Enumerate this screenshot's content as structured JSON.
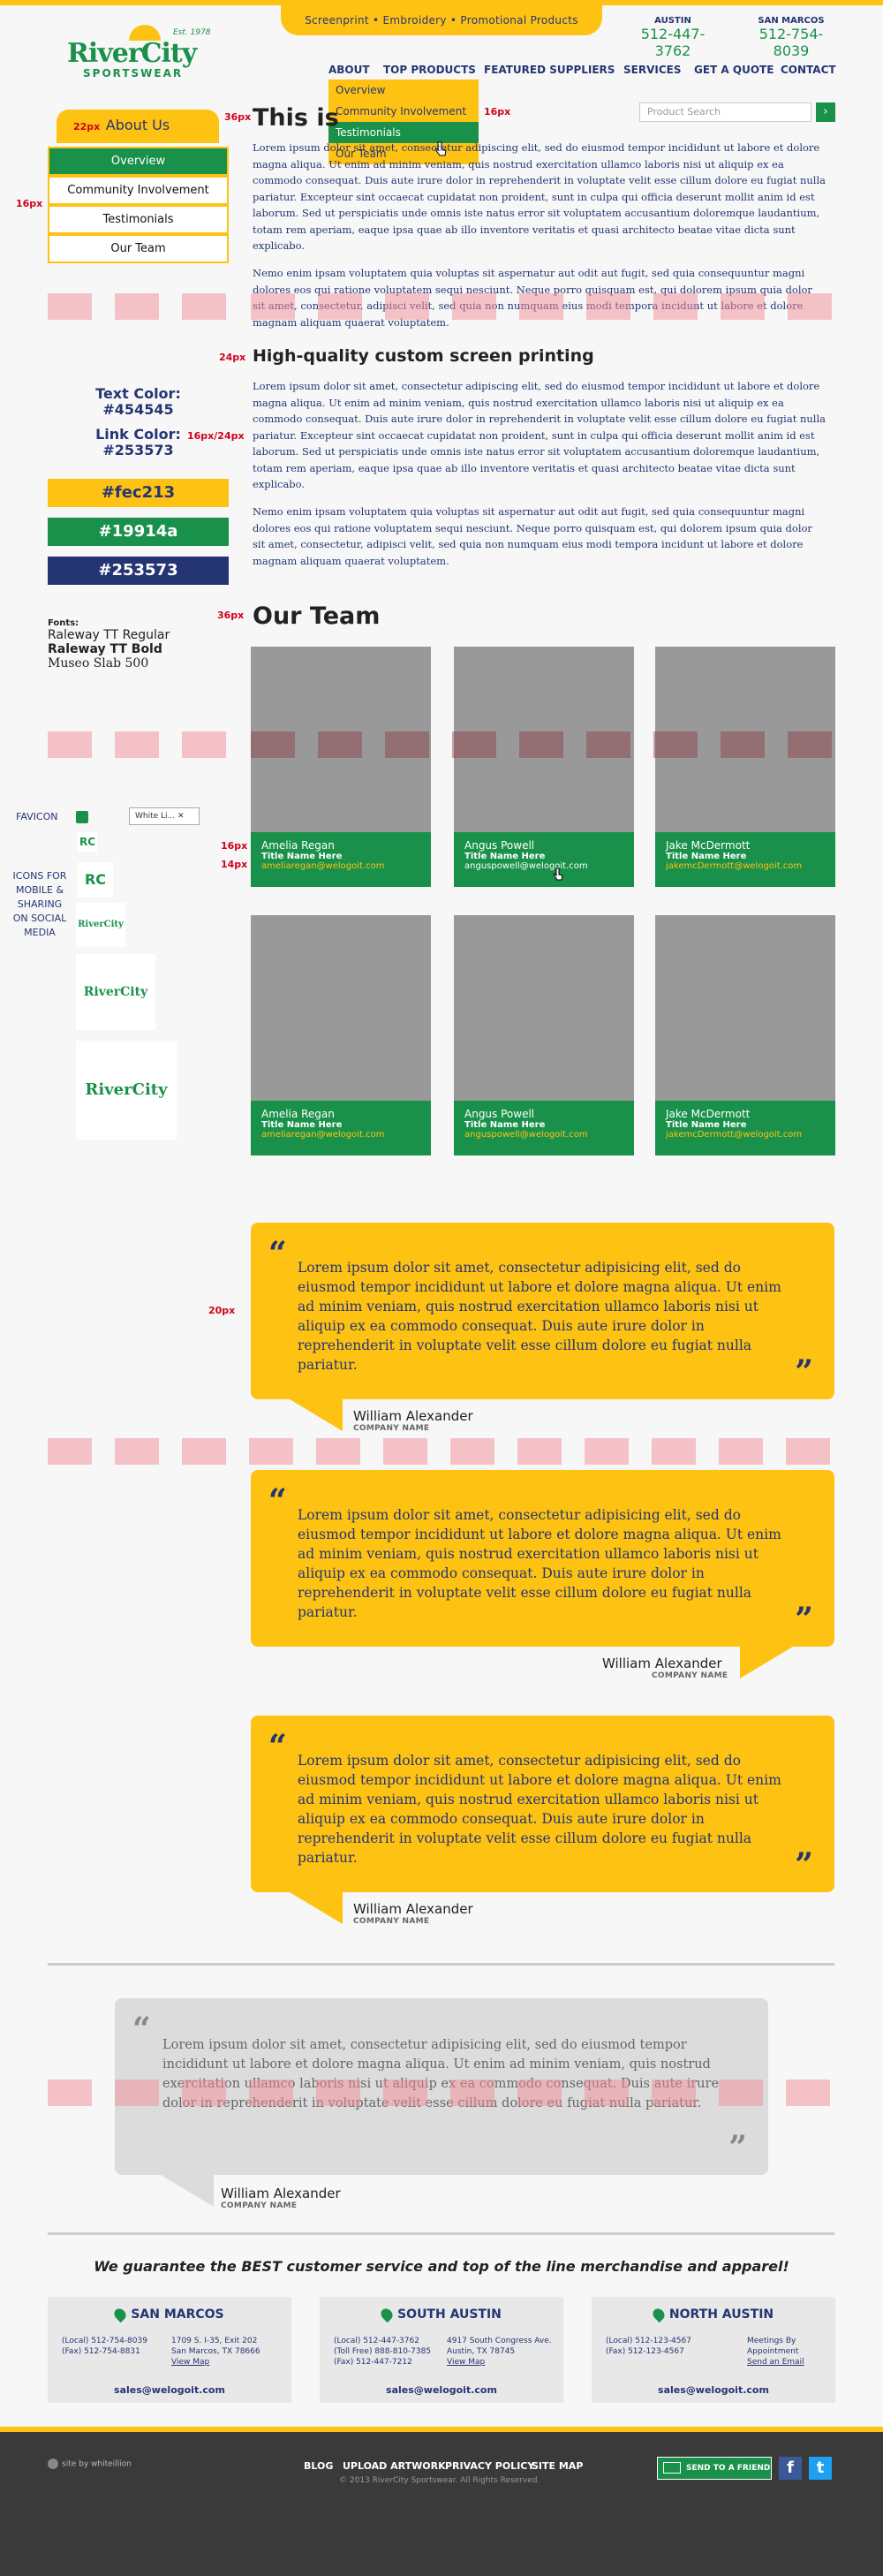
{
  "header": {
    "tagline": "Screenprint • Embroidery • Promotional Products",
    "logo": {
      "name": "RiverCity",
      "sub": "SPORTSWEAR",
      "est": "Est. 1978"
    },
    "cities": [
      {
        "name": "AUSTIN",
        "phone": "512-447-3762"
      },
      {
        "name": "SAN MARCOS",
        "phone": "512-754-8039"
      }
    ]
  },
  "nav": {
    "items": [
      "ABOUT",
      "TOP PRODUCTS",
      "FEATURED SUPPLIERS",
      "SERVICES",
      "GET A QUOTE",
      "CONTACT"
    ],
    "dropdown": [
      "Overview",
      "Community Involvement",
      "Testimonials",
      "Our Team"
    ]
  },
  "search": {
    "placeholder": "Product Search"
  },
  "sidebar": {
    "title": "About Us",
    "items": [
      "Overview",
      "Community Involvement",
      "Testimonials",
      "Our Team"
    ]
  },
  "annotations": {
    "px22": "22px",
    "px36": "36px",
    "px16": "16px",
    "px24": "24px",
    "px16_24": "16px/24px",
    "px14": "14px",
    "px20": "20px"
  },
  "main": {
    "h1": "This is",
    "p1": "Lorem ipsum dolor sit amet, consectetur adipiscing elit, sed do eiusmod tempor incididunt ut labore et dolore magna aliqua. Ut enim ad minim veniam, quis nostrud exercitation ullamco laboris nisi ut aliquip ex ea commodo consequat. Duis aute irure dolor in reprehenderit in voluptate velit esse cillum dolore eu fugiat nulla pariatur. Excepteur sint occaecat cupidatat non proident, sunt in culpa qui officia deserunt mollit anim id est laborum. Sed ut perspiciatis unde omnis iste natus error sit voluptatem accusantium doloremque laudantium, totam rem aperiam, eaque ipsa quae ab illo inventore veritatis et quasi architecto beatae vitae dicta sunt explicabo.",
    "p2": "Nemo enim ipsam voluptatem quia voluptas sit aspernatur aut odit aut fugit, sed quia consequuntur magni dolores eos qui ratione voluptatem sequi nesciunt. Neque porro quisquam est, qui dolorem ipsum quia dolor sit amet, consectetur, adipisci velit, sed quia non numquam eius modi tempora incidunt ut labore et dolore magnam aliquam quaerat voluptatem.",
    "h2": "High-quality custom screen printing",
    "p3": "Lorem ipsum dolor sit amet, consectetur adipiscing elit, sed do eiusmod tempor incididunt ut labore et dolore magna aliqua. Ut enim ad minim veniam, quis nostrud exercitation ullamco laboris nisi ut aliquip ex ea commodo consequat. Duis aute irure dolor in reprehenderit in voluptate velit esse cillum dolore eu fugiat nulla pariatur. Excepteur sint occaecat cupidatat non proident, sunt in culpa qui officia deserunt mollit anim id est laborum. Sed ut perspiciatis unde omnis iste natus error sit voluptatem accusantium doloremque laudantium, totam rem aperiam, eaque ipsa quae ab illo inventore veritatis et quasi architecto beatae vitae dicta sunt explicabo.",
    "p4": "Nemo enim ipsam voluptatem quia voluptas sit aspernatur aut odit aut fugit, sed quia consequuntur magni dolores eos qui ratione voluptatem sequi nesciunt. Neque porro quisquam est, qui dolorem ipsum quia dolor sit amet, consectetur, adipisci velit, sed quia non numquam eius modi tempora incidunt ut labore et dolore magnam aliquam quaerat voluptatem.",
    "team_title": "Our Team"
  },
  "style_guide": {
    "text_color_label": "Text Color:",
    "text_color": "#454545",
    "link_color_label": "Link Color:",
    "link_color": "#253573",
    "swatches": [
      "#fec213",
      "#19914a",
      "#253573"
    ],
    "fonts_label": "Fonts:",
    "fonts": [
      "Raleway TT Regular",
      "Raleway TT Bold",
      "Museo Slab 500"
    ],
    "favicon_label": "FAVICON",
    "favicon_tab": "White Li...",
    "icons_label": "ICONS FOR MOBILE & SHARING ON SOCIAL MEDIA"
  },
  "team": [
    {
      "name": "Amelia Regan",
      "title": "Title Name Here",
      "email": "ameliaregan@welogoit.com"
    },
    {
      "name": "Angus Powell",
      "title": "Title Name Here",
      "email": "anguspowell@welogoit.com"
    },
    {
      "name": "Jake McDermott",
      "title": "Title Name Here",
      "email": "jakemcDermott@welogoit.com"
    },
    {
      "name": "Amelia Regan",
      "title": "Title Name Here",
      "email": "ameliaregan@welogoit.com"
    },
    {
      "name": "Angus Powell",
      "title": "Title Name Here",
      "email": "anguspowell@welogoit.com"
    },
    {
      "name": "Jake McDermott",
      "title": "Title Name Here",
      "email": "jakemcDermott@welogoit.com"
    }
  ],
  "testimonials": {
    "text": "Lorem ipsum dolor sit amet, consectetur adipisicing elit, sed do eiusmod tempor incididunt ut labore et dolore magna aliqua. Ut enim ad minim veniam, quis nostrud exercitation ullamco laboris nisi ut aliquip ex ea commodo consequat. Duis aute irure dolor in reprehenderit in voluptate velit esse cillum dolore eu fugiat nulla pariatur.",
    "name": "William Alexander",
    "company": "COMPANY NAME"
  },
  "guarantee": "We guarantee the BEST customer service and top of the line merchandise and apparel!",
  "locations": [
    {
      "name": "SAN MARCOS",
      "phones": [
        "(Local) 512-754-8039",
        "(Fax) 512-754-8831"
      ],
      "address": [
        "1709 S. I-35, Exit 202",
        "San Marcos, TX 78666",
        "View Map"
      ],
      "email": "sales@welogoit.com"
    },
    {
      "name": "SOUTH AUSTIN",
      "phones": [
        "(Local) 512-447-3762",
        "(Toll Free) 888-810-7385",
        "(Fax) 512-447-7212"
      ],
      "address": [
        "4917 South Congress Ave.",
        "Austin, TX 78745",
        "View Map"
      ],
      "email": "sales@welogoit.com"
    },
    {
      "name": "NORTH AUSTIN",
      "phones": [
        "(Local) 512-123-4567",
        "(Fax) 512-123-4567"
      ],
      "address": [
        "Meetings By",
        "Appointment",
        "Send an Email"
      ],
      "email": "sales@welogoit.com"
    }
  ],
  "footer": {
    "credit": "site by whiteillion",
    "links": [
      "BLOG",
      "UPLOAD ARTWORK",
      "PRIVACY POLICY",
      "SITE MAP"
    ],
    "copyright": "© 2013 RiverCity Sportswear. All Rights Reserved.",
    "send_friend": "SEND TO A FRIEND",
    "fb": "f",
    "tw": "t"
  }
}
